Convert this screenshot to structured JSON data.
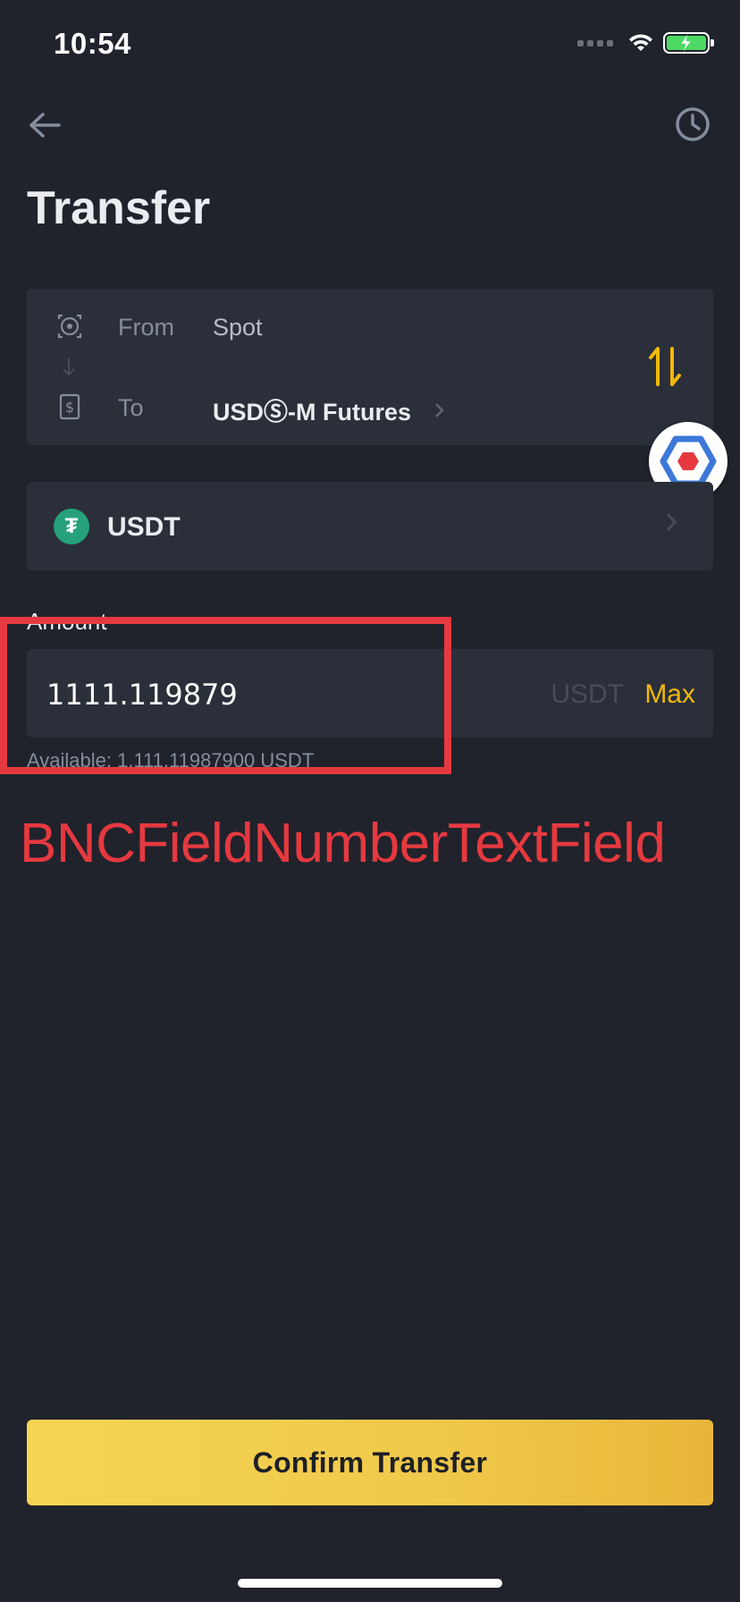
{
  "status_bar": {
    "time": "10:54"
  },
  "header": {
    "title": "Transfer"
  },
  "transfer": {
    "from_label": "From",
    "from_value": "Spot",
    "to_label": "To",
    "to_value": "USDⓈ-M Futures"
  },
  "coin": {
    "name": "USDT",
    "logo_symbol": "₮"
  },
  "amount": {
    "label": "Amount",
    "value": "1111.119879",
    "unit": "USDT",
    "max_label": "Max",
    "available": "Available: 1,111.11987900 USDT"
  },
  "annotation": {
    "label": "BNCFieldNumberTextField",
    "color": "#e5393f"
  },
  "footer": {
    "confirm_label": "Confirm Transfer"
  },
  "colors": {
    "background": "#20232c",
    "card": "#2b2f3a",
    "accent": "#f0b90b",
    "usdt": "#26a17b"
  },
  "icons": [
    "back-arrow-icon",
    "history-clock-icon",
    "wallet-icon",
    "arrow-down-icon",
    "dollar-card-icon",
    "chevron-right-icon",
    "swap-icon",
    "usdt-logo-icon",
    "assistive-badge-icon",
    "wifi-icon",
    "battery-icon"
  ]
}
